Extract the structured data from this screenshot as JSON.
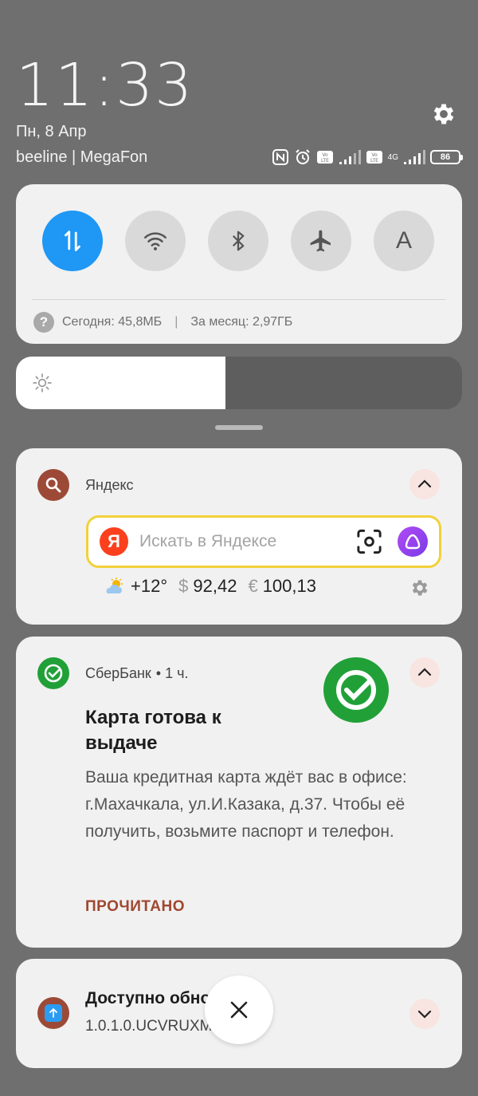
{
  "header": {
    "time": "11:33",
    "date": "Пн, 8 Апр",
    "carrier": "beeline | MegaFon",
    "battery": "86",
    "network": "4G"
  },
  "quick_settings": {
    "toggles": [
      {
        "name": "mobile-data",
        "active": true
      },
      {
        "name": "wifi",
        "active": false
      },
      {
        "name": "bluetooth",
        "active": false
      },
      {
        "name": "airplane",
        "active": false
      },
      {
        "name": "auto-rotate",
        "label": "A",
        "active": false
      }
    ],
    "traffic_today": "Сегодня: 45,8МБ",
    "traffic_separator": "|",
    "traffic_month": "За месяц: 2,97ГБ",
    "help_glyph": "?"
  },
  "brightness": {
    "level": 0.47
  },
  "yandex": {
    "app_name": "Яндекс",
    "logo_letter": "Я",
    "search_placeholder": "Искать в Яндексе",
    "temperature": "+12°",
    "usd_symbol": "$",
    "usd_rate": "92,42",
    "eur_symbol": "€",
    "eur_rate": "100,13"
  },
  "sber": {
    "app_name": "СберБанк",
    "time_ago": "• 1 ч.",
    "title": "Карта готова к выдаче",
    "text": "Ваша кредитная карта ждёт вас в офисе: г.Махачкала, ул.И.Казака, д.37. Чтобы её получить, возьмите паспорт и телефон.",
    "action": "ПРОЧИТАНО"
  },
  "update": {
    "title": "Доступно обновление",
    "version": "1.0.1.0.UCVRUXM"
  },
  "colors": {
    "accent_blue": "#1e97f5",
    "yandex_red": "#fc3f1d",
    "sber_green": "#21a038",
    "action_brown": "#a0472f"
  }
}
